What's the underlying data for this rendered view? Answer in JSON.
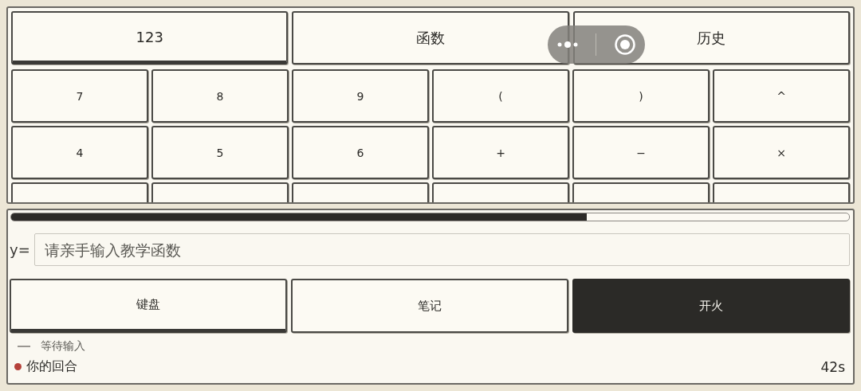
{
  "tabs": [
    {
      "label": "123",
      "selected": true
    },
    {
      "label": "函数",
      "selected": false
    },
    {
      "label": "历史",
      "selected": false
    }
  ],
  "keypad": {
    "rows": [
      [
        {
          "kind": "key",
          "label": "7"
        },
        {
          "kind": "key",
          "label": "8"
        },
        {
          "kind": "key",
          "label": "9"
        },
        {
          "kind": "key",
          "label": "("
        },
        {
          "kind": "key",
          "label": ")"
        },
        {
          "kind": "key",
          "label": "^"
        }
      ],
      [
        {
          "kind": "key",
          "label": "4"
        },
        {
          "kind": "key",
          "label": "5"
        },
        {
          "kind": "key",
          "label": "6"
        },
        {
          "kind": "key",
          "label": "+"
        },
        {
          "kind": "key",
          "label": "−"
        },
        {
          "kind": "key",
          "label": "×"
        }
      ],
      [
        {
          "kind": "blank"
        },
        {
          "kind": "blank"
        },
        {
          "kind": "blank"
        },
        {
          "kind": "blank"
        },
        {
          "kind": "blank"
        },
        {
          "kind": "blank"
        }
      ]
    ]
  },
  "timer_bar": {
    "level": 0.687
  },
  "input": {
    "prefix": "y=",
    "placeholder": "请亲手输入教学函数"
  },
  "actions": [
    {
      "label": "键盘",
      "kind": "toggle",
      "selected": true
    },
    {
      "label": "笔记",
      "kind": "toggle",
      "selected": false
    },
    {
      "label": "开火",
      "kind": "primary",
      "selected": false
    }
  ],
  "status": {
    "message": "等待输入",
    "turn": {
      "label": "你的回合",
      "color": "#b5413a"
    },
    "time": "42s"
  }
}
